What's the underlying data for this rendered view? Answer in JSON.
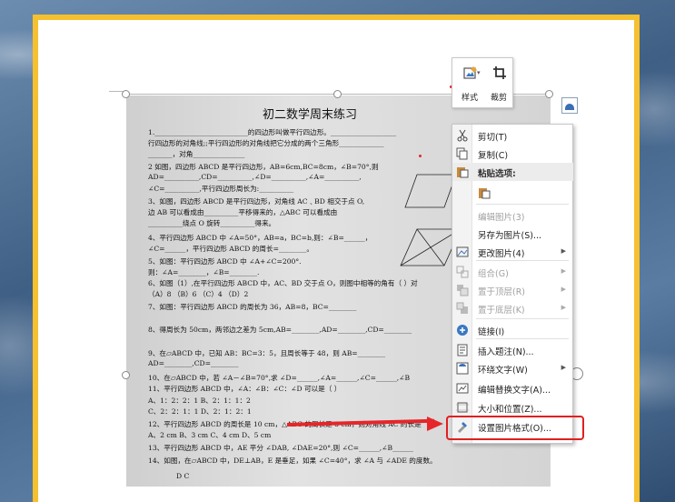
{
  "document": {
    "title": "初二数学周末练习",
    "lines": [
      "1.___________________________的四边形叫做平行四边形。___________________",
      "行四边形的对角线;;平行四边形的对角线把它分成的两个三角形_____________",
      "_______，对角_______________",
      "2 如图，四边形 ABCD 是平行四边形，AB=6cm,BC=8cm，∠B=70°,则",
      "AD=__________,CD=__________,∠D=__________,∠A=__________,",
      "∠C=__________,平行四边形周长为:__________",
      "3、如图，四边形 ABCD 是平行四边形，对角线 AC﹑BD 相交于点 O,",
      "边 AB 可以看成由__________平移得来的，△ABC 可以看成由",
      "__________绕点 O 旋转__________得来。",
      "4、平行四边形 ABCD 中 ∠A=50°，AB=a，BC=b,则：∠B=______，",
      "∠C=______，平行四边形 ABCD 的周长=________。",
      "5、如图：平行四边形 ABCD 中 ∠A+∠C=200°.",
      "则：∠A=________，∠B=________.",
      "6、如图（1）,在平行四边形 ABCD 中，AC、BD 交于点 O，则图中相等的角有（ ）对",
      "（A）8  （B）6  （C）4  （D）2",
      "7、如图：平行四边形 ABCD 的周长为 36，AB=8，BC=________",
      "8、得周长为 50cm，两邻边之差为 5cm,AB=________,AD=________,CD=________",
      "9、在▱ABCD 中，已知 AB：BC=3：5，且周长等于 48，则 AB=________",
      "AD=________,CD=________",
      "10、在▱ABCD 中，若 ∠A－∠B=70°,求 ∠D=______,∠A=______,∠C=______,∠B",
      "11、平行四边形 ABCD 中，∠A：∠B：∠C：∠D 可以是（ ）",
      "A、1：2：2：1          B、2：1：1：2",
      "C、2：2：1：1          D、2：1：2：1",
      "12、平行四边形 ABCD 的周长是 10 cm，△ABC 的周长是 8 cm，则对角线 AC 的长是",
      "A、2 cm        B、3 cm        C、4 cm        D、5 cm",
      "13、平行四边形 ABCD 中，AE 平分 ∠DAB, ∠DAE=20°,则 ∠C=______,∠B______",
      "14、如图，在▱ABCD 中，DE⊥AB，E 是垂足，如果 ∠C=40°，求 ∠A 与 ∠ADE 的度数。",
      "D                C"
    ]
  },
  "mini_toolbar": {
    "style_label": "样式",
    "crop_label": "裁剪"
  },
  "context_menu": {
    "items": [
      {
        "label": "剪切(T)",
        "icon": "scissors-icon",
        "disabled": false,
        "submenu": false
      },
      {
        "label": "复制(C)",
        "icon": "copy-icon",
        "disabled": false,
        "submenu": false
      },
      {
        "label": "粘贴选项:",
        "icon": "paste-icon",
        "disabled": false,
        "submenu": false,
        "header": true
      },
      {
        "label": "",
        "icon": "paste-keep-icon",
        "disabled": false,
        "submenu": false
      },
      {
        "label": "编辑图片(3)",
        "icon": "",
        "disabled": true,
        "submenu": false
      },
      {
        "label": "另存为图片(S)...",
        "icon": "",
        "disabled": false,
        "submenu": false
      },
      {
        "label": "更改图片(4)",
        "icon": "change-picture-icon",
        "disabled": false,
        "submenu": true
      },
      {
        "label": "组合(G)",
        "icon": "group-icon",
        "disabled": true,
        "submenu": true
      },
      {
        "label": "置于顶层(R)",
        "icon": "bring-front-icon",
        "disabled": true,
        "submenu": true
      },
      {
        "label": "置于底层(K)",
        "icon": "send-back-icon",
        "disabled": true,
        "submenu": true
      },
      {
        "label": "链接(I)",
        "icon": "link-icon",
        "disabled": false,
        "submenu": false
      },
      {
        "label": "插入题注(N)...",
        "icon": "caption-icon",
        "disabled": false,
        "submenu": false
      },
      {
        "label": "环绕文字(W)",
        "icon": "wrap-text-icon",
        "disabled": false,
        "submenu": true
      },
      {
        "label": "编辑替换文字(A)...",
        "icon": "alt-text-icon",
        "disabled": false,
        "submenu": false
      },
      {
        "label": "大小和位置(Z)...",
        "icon": "size-position-icon",
        "disabled": false,
        "submenu": false
      },
      {
        "label": "设置图片格式(O)...",
        "icon": "format-picture-icon",
        "disabled": false,
        "submenu": false
      }
    ]
  },
  "colors": {
    "accent_border": "#f6c02e",
    "annotation_red": "#e02020"
  }
}
